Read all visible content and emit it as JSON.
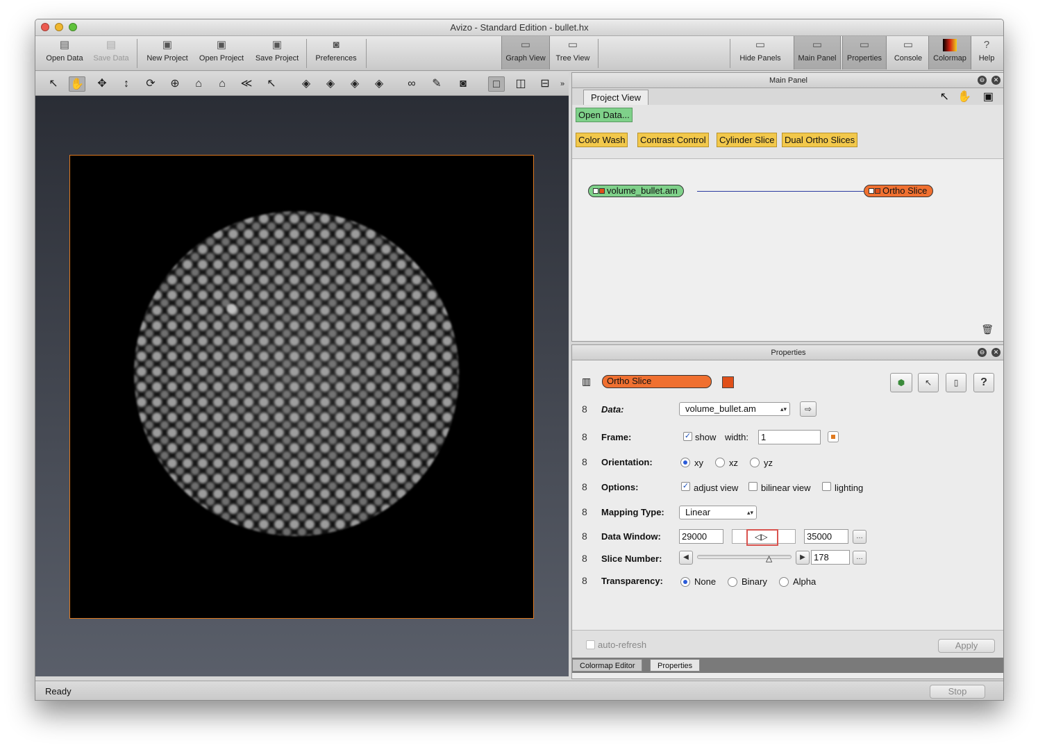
{
  "window": {
    "title": "Avizo - Standard Edition - bullet.hx"
  },
  "toolbar": {
    "open_data": "Open Data",
    "save_data": "Save Data",
    "new_project": "New Project",
    "open_project": "Open Project",
    "save_project": "Save Project",
    "preferences": "Preferences",
    "graph_view": "Graph View",
    "tree_view": "Tree View",
    "hide_panels": "Hide Panels",
    "main_panel": "Main Panel",
    "properties": "Properties",
    "console": "Console",
    "colormap": "Colormap",
    "help": "Help"
  },
  "main_panel": {
    "header": "Main Panel",
    "tab_project_view": "Project View",
    "open_data_btn": "Open Data...",
    "quick_modules": [
      "Color Wash",
      "Contrast Control",
      "Cylinder Slice",
      "Dual Ortho Slices"
    ],
    "nodes": {
      "data_node": "volume_bullet.am",
      "module_node": "Ortho Slice"
    }
  },
  "properties": {
    "header": "Properties",
    "module_name": "Ortho Slice",
    "data_label": "Data:",
    "data_value": "volume_bullet.am",
    "frame_label": "Frame:",
    "frame_show": "show",
    "frame_width_label": "width:",
    "frame_width_value": "1",
    "orientation_label": "Orientation:",
    "orientation_options": [
      "xy",
      "xz",
      "yz"
    ],
    "orientation_selected": "xy",
    "options_label": "Options:",
    "option_adjust_view": "adjust view",
    "option_bilinear_view": "bilinear view",
    "option_lighting": "lighting",
    "mapping_label": "Mapping Type:",
    "mapping_value": "Linear",
    "data_window_label": "Data Window:",
    "data_window_min": "29000",
    "data_window_max": "35000",
    "slice_label": "Slice Number:",
    "slice_value": "178",
    "transparency_label": "Transparency:",
    "transparency_options": [
      "None",
      "Binary",
      "Alpha"
    ],
    "transparency_selected": "None",
    "auto_refresh": "auto-refresh",
    "apply": "Apply"
  },
  "bottom_tabs": [
    "Colormap Editor",
    "Properties"
  ],
  "status": {
    "text": "Ready",
    "stop": "Stop"
  },
  "colors": {
    "accent_orange": "#f07030",
    "node_green": "#7fd18a",
    "module_yellow": "#f2c84b"
  }
}
